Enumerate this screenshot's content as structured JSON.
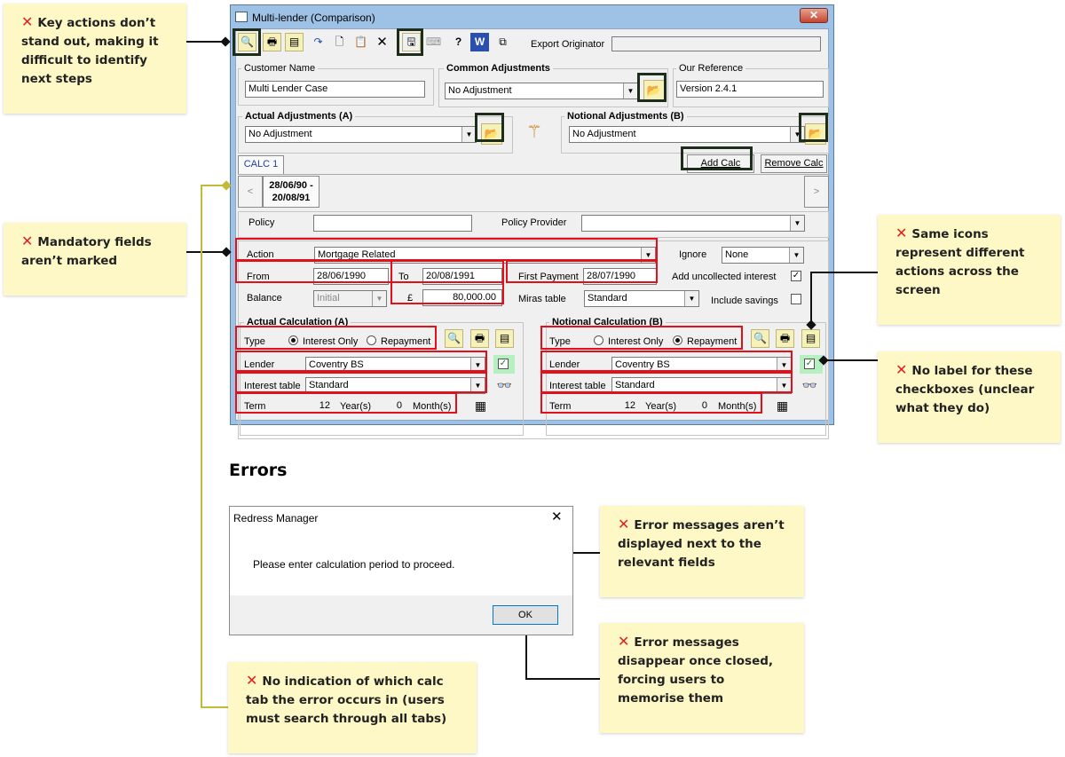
{
  "window": {
    "title": "Multi-lender (Comparison)",
    "close": "✕",
    "export_originator_label": "Export Originator",
    "export_originator_value": ""
  },
  "toolbar": {
    "icons": [
      "preview-icon",
      "print-icon",
      "pdf-icon",
      "redo-icon",
      "new-document-icon",
      "paste-icon",
      "delete-icon",
      "save-icon",
      "keyboard-icon",
      "help-icon",
      "word-icon",
      "copy-windows-icon"
    ]
  },
  "customer": {
    "label": "Customer Name",
    "value": "Multi Lender Case"
  },
  "common_adjustments": {
    "label": "Common Adjustments",
    "value": "No Adjustment"
  },
  "our_reference": {
    "label": "Our Reference",
    "value": "Version 2.4.1"
  },
  "actual_adjustments": {
    "label": "Actual Adjustments (A)",
    "value": "No Adjustment"
  },
  "notional_adjustments": {
    "label": "Notional Adjustments (B)",
    "value": "No Adjustment"
  },
  "tabs": {
    "calc_tab": "CALC 1",
    "add_calc": "Add Calc",
    "remove_calc": "Remove Calc",
    "period_line1": "28/06/90 -",
    "period_line2": "20/08/91",
    "prev": "<",
    "next": ">"
  },
  "policy": {
    "label": "Policy",
    "value": "",
    "provider_label": "Policy Provider",
    "provider_value": ""
  },
  "fields": {
    "action_label": "Action",
    "action_value": "Mortgage Related",
    "ignore_label": "Ignore",
    "ignore_value": "None",
    "from_label": "From",
    "from_value": "28/06/1990",
    "to_label": "To",
    "to_value": "20/08/1991",
    "first_payment_label": "First Payment",
    "first_payment_value": "28/07/1990",
    "add_uncollected_label": "Add uncollected interest",
    "balance_label": "Balance",
    "balance_value": "Initial",
    "currency": "£",
    "amount_value": "80,000.00",
    "miras_label": "Miras table",
    "miras_value": "Standard",
    "include_savings_label": "Include savings"
  },
  "actual_calc": {
    "title": "Actual Calculation (A)",
    "type_label": "Type",
    "option1": "Interest Only",
    "option2": "Repayment",
    "lender_label": "Lender",
    "lender_value": "Coventry BS",
    "interest_label": "Interest table",
    "interest_value": "Standard",
    "term_label": "Term",
    "term_years": "12",
    "years_label": "Year(s)",
    "term_months": "0",
    "months_label": "Month(s)"
  },
  "notional_calc": {
    "title": "Notional Calculation (B)",
    "type_label": "Type",
    "option1": "Interest Only",
    "option2": "Repayment",
    "lender_label": "Lender",
    "lender_value": "Coventry BS",
    "interest_label": "Interest table",
    "interest_value": "Standard",
    "term_label": "Term",
    "term_years": "12",
    "years_label": "Year(s)",
    "term_months": "0",
    "months_label": "Month(s)"
  },
  "errors_heading": "Errors",
  "message_box": {
    "title": "Redress Manager",
    "close": "✕",
    "text": "Please enter calculation period to proceed.",
    "ok": "OK"
  },
  "notes": {
    "mark": "✕",
    "key_actions": "Key actions don’t stand out, making it difficult to identify next steps",
    "mandatory": "Mandatory fields aren’t marked",
    "same_icons": "Same icons represent different actions across the screen",
    "no_label": "No label for these checkboxes (unclear what they do)",
    "error_not_next": "Error messages aren’t displayed next to the relevant fields",
    "error_disappear": "Error messages disappear once closed, forcing users to memorise them",
    "no_indication": "No indication of which calc tab the error occurs in (users must search through all tabs)"
  },
  "colors": {
    "highlight": "#e3101b",
    "emphasis": "#1d2c1b",
    "note_bg": "#fdf8c5",
    "connector_yellow": "#c2bb36"
  }
}
